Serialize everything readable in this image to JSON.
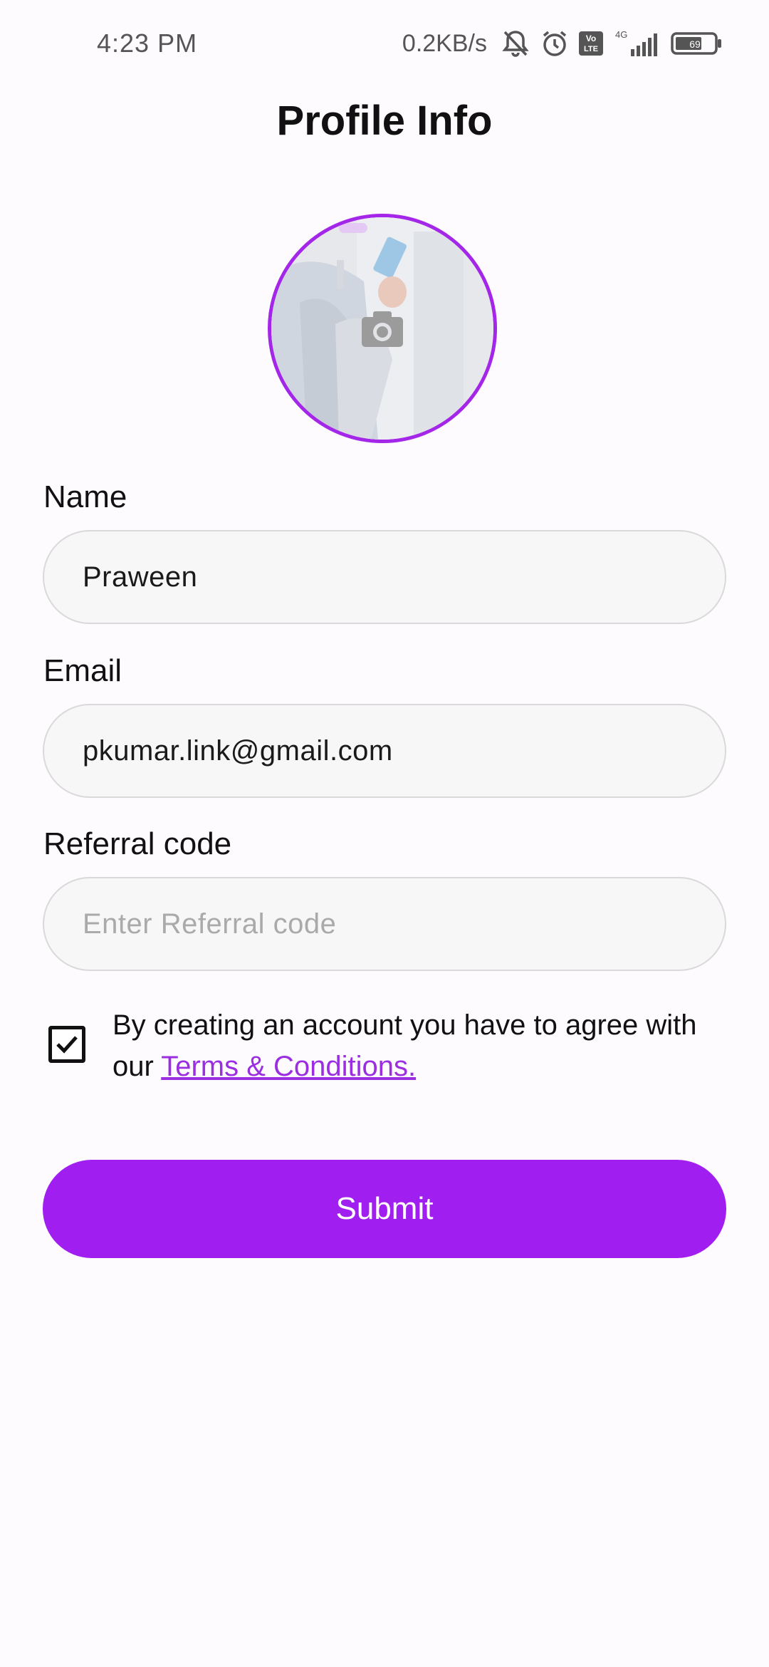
{
  "status_bar": {
    "time": "4:23 PM",
    "net_speed": "0.2KB/s",
    "network_type": "4G",
    "volte_label": "Vo LTE",
    "battery_level": "69",
    "icons": [
      "silent-bell-icon",
      "alarm-icon",
      "volte-icon",
      "signal-icon",
      "battery-icon"
    ]
  },
  "header": {
    "title": "Profile Info"
  },
  "avatar": {
    "icon": "camera-icon",
    "border_color": "#a426e8"
  },
  "form": {
    "name": {
      "label": "Name",
      "value": "Praween"
    },
    "email": {
      "label": "Email",
      "value": "pkumar.link@gmail.com"
    },
    "referral": {
      "label": "Referral code",
      "value": "",
      "placeholder": "Enter Referral code"
    }
  },
  "terms": {
    "checked": true,
    "text": "By creating an account you have to agree with our ",
    "link_text": "Terms & Conditions.",
    "link_color": "#9a2ee0"
  },
  "submit": {
    "label": "Submit",
    "color": "#a11ef0"
  }
}
